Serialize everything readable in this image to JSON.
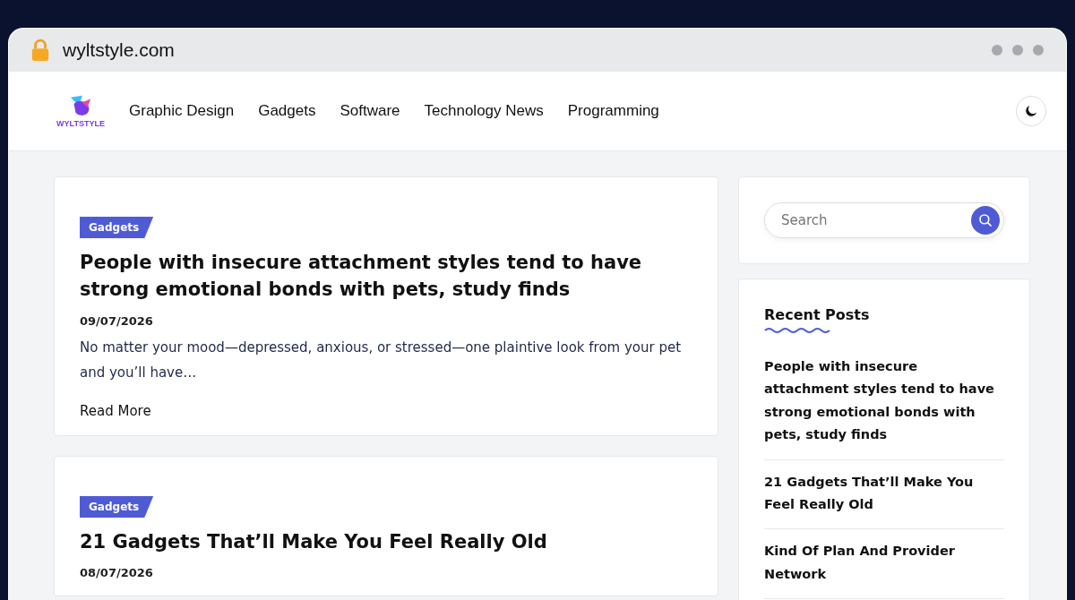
{
  "browser": {
    "url": "wyltstyle.com"
  },
  "site": {
    "logo_text": "WYLTSTYLE"
  },
  "nav": {
    "items": [
      {
        "label": "Graphic Design"
      },
      {
        "label": "Gadgets"
      },
      {
        "label": "Software"
      },
      {
        "label": "Technology News"
      },
      {
        "label": "Programming"
      }
    ]
  },
  "posts": [
    {
      "category": "Gadgets",
      "title": "People with insecure attachment styles tend to have strong emotional bonds with pets, study finds",
      "date": "09/07/2026",
      "excerpt": "No matter your mood—depressed, anxious, or stressed—one plaintive look from your pet and you’ll have…",
      "read_more": "Read More"
    },
    {
      "category": "Gadgets",
      "title": "21 Gadgets That’ll Make You Feel Really Old",
      "date": "08/07/2026"
    }
  ],
  "sidebar": {
    "search": {
      "placeholder": "Search"
    },
    "recent_posts": {
      "title": "Recent Posts",
      "items": [
        {
          "title": "People with insecure attachment styles tend to have strong emotional bonds with pets, study finds"
        },
        {
          "title": "21 Gadgets That’ll Make You Feel Really Old"
        },
        {
          "title": "Kind Of Plan And Provider Network"
        }
      ]
    }
  }
}
